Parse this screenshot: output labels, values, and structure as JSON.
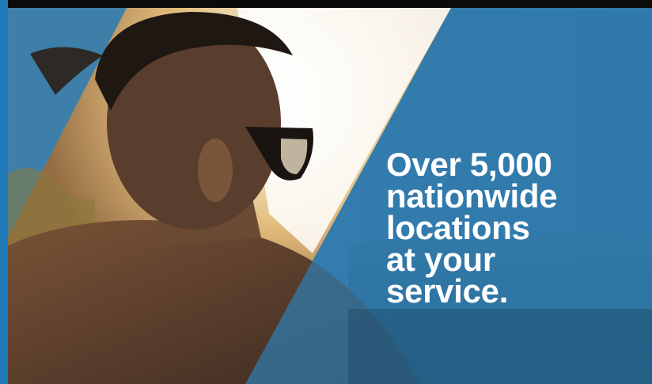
{
  "banner": {
    "headline_lines": [
      "Over 5,000",
      "nationwide",
      "locations",
      "at your",
      "service."
    ],
    "colors": {
      "brand_blue": "#3a7fae",
      "accent_blue": "#1f78b8",
      "headline_text": "#ffffff",
      "sun_glow": "#fff6dc"
    }
  }
}
